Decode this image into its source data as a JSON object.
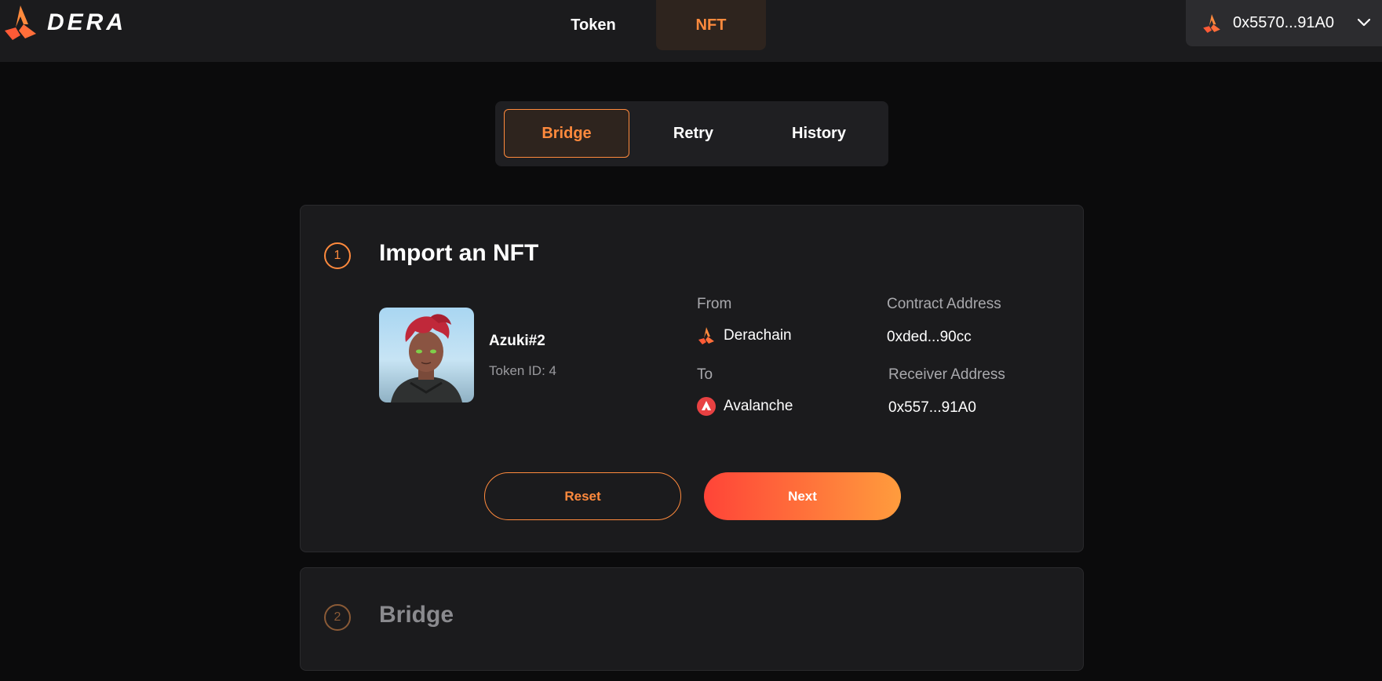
{
  "header": {
    "logo_text": "DERA",
    "nav": [
      {
        "label": "Token"
      },
      {
        "label": "NFT"
      }
    ],
    "wallet_address": "0x5570...91A0"
  },
  "subtabs": [
    {
      "label": "Bridge"
    },
    {
      "label": "Retry"
    },
    {
      "label": "History"
    }
  ],
  "step1": {
    "number": "1",
    "title": "Import an NFT",
    "nft": {
      "name": "Azuki#2",
      "token_id": "Token ID: 4"
    },
    "from_label": "From",
    "from_value": "Derachain",
    "contract_label": "Contract Address",
    "contract_value": "0xded...90cc",
    "to_label": "To",
    "to_value": "Avalanche",
    "receiver_label": "Receiver Address",
    "receiver_value": "0x557...91A0",
    "reset_label": "Reset",
    "next_label": "Next"
  },
  "step2": {
    "number": "2",
    "title": "Bridge"
  },
  "colors": {
    "accent": "#ff8a3d",
    "gradient_start": "#ff4438",
    "gradient_end": "#ff9c3d",
    "avalanche_red": "#e84142"
  }
}
